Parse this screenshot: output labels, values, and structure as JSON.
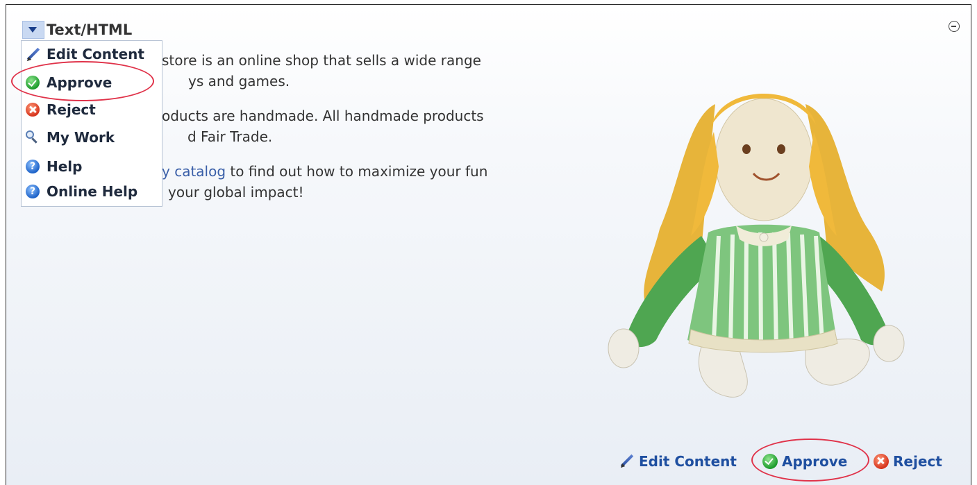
{
  "widget": {
    "title": "Text/HTML"
  },
  "menu": {
    "items": [
      {
        "label": "Edit Content",
        "icon": "pencil-icon"
      },
      {
        "label": "Approve",
        "icon": "approve-check-icon"
      },
      {
        "label": "Reject",
        "icon": "reject-x-icon"
      },
      {
        "label": "My Work",
        "icon": "magnifier-icon"
      },
      {
        "label": "Help",
        "icon": "help-icon"
      },
      {
        "label": "Online Help",
        "icon": "help-icon"
      }
    ]
  },
  "content": {
    "p1_line1": "store is an online shop that sells a wide range",
    "p1_line2": "ys and games.",
    "p2_line1": "oducts are handmade. All handmade products",
    "p2_line2": "d Fair Trade.",
    "p3_link": "y catalog",
    "p3_line1_rest": " to find out how to maximize your fun",
    "p3_line2": "your global impact!"
  },
  "footer": {
    "edit_label": "Edit Content",
    "approve_label": "Approve",
    "reject_label": "Reject"
  },
  "colors": {
    "link": "#3a5fa8",
    "footer_link": "#1f4fa0",
    "highlight": "#e0334a"
  }
}
